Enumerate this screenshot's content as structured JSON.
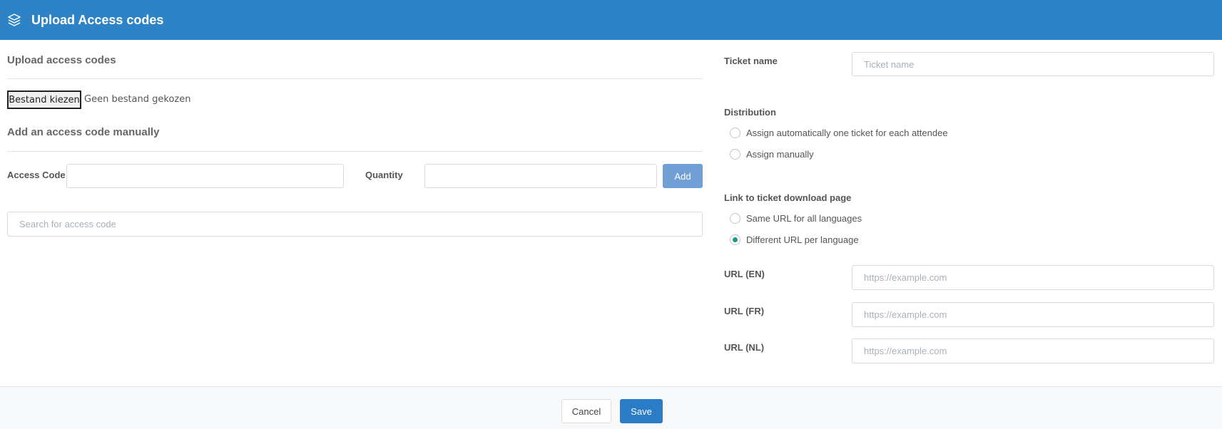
{
  "header": {
    "title": "Upload Access codes",
    "icon": "layers-icon",
    "background": "#2d83c6"
  },
  "upload": {
    "section_title": "Upload access codes",
    "file_button_label": "Bestand kiezen",
    "file_status": "Geen bestand gekozen"
  },
  "manual": {
    "section_title": "Add an access code manually",
    "access_code_label": "Access Code",
    "access_code_value": "",
    "quantity_label": "Quantity",
    "quantity_value": "",
    "add_label": "Add"
  },
  "search": {
    "placeholder": "Search for access code",
    "value": ""
  },
  "ticket": {
    "name_label": "Ticket name",
    "name_placeholder": "Ticket name",
    "name_value": ""
  },
  "distribution": {
    "label": "Distribution",
    "options": [
      {
        "label": "Assign automatically one ticket for each attendee",
        "checked": false
      },
      {
        "label": "Assign manually",
        "checked": false
      }
    ]
  },
  "link": {
    "label": "Link to ticket download page",
    "options": [
      {
        "label": "Same URL for all languages",
        "checked": false
      },
      {
        "label": "Different URL per language",
        "checked": true
      }
    ]
  },
  "urls": [
    {
      "label": "URL (EN)",
      "placeholder": "https://example.com",
      "value": ""
    },
    {
      "label": "URL (FR)",
      "placeholder": "https://example.com",
      "value": ""
    },
    {
      "label": "URL (NL)",
      "placeholder": "https://example.com",
      "value": ""
    }
  ],
  "footer": {
    "cancel_label": "Cancel",
    "save_label": "Save",
    "save_color": "#2a7cc7"
  }
}
